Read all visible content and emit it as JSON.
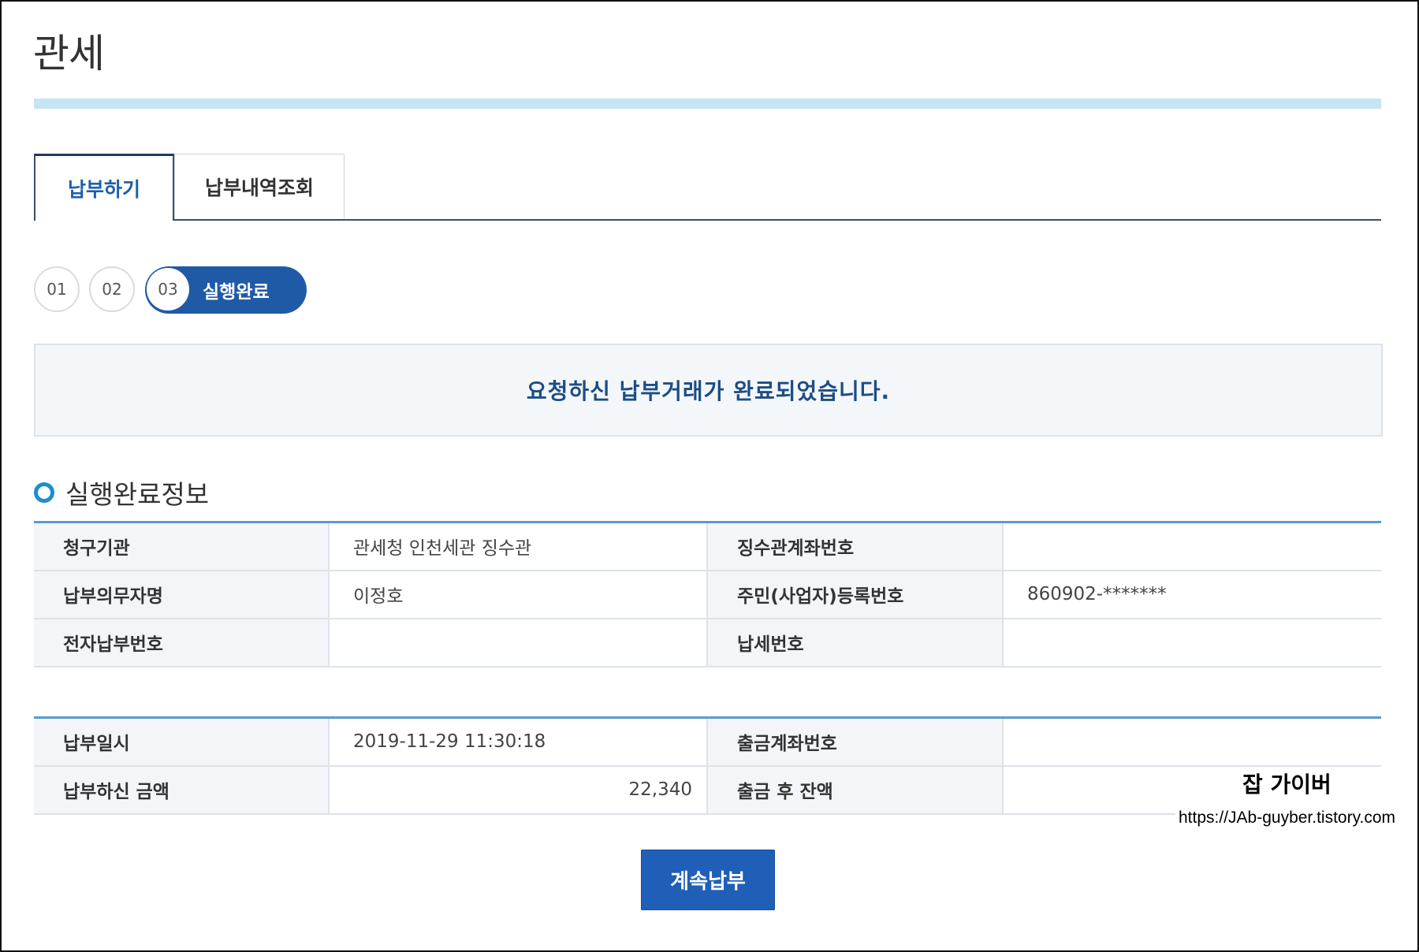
{
  "page": {
    "title": "관세"
  },
  "tabs": [
    {
      "label": "납부하기",
      "active": true
    },
    {
      "label": "납부내역조회",
      "active": false
    }
  ],
  "steps": {
    "items": [
      "01",
      "02",
      "03"
    ],
    "current_label": "실행완료"
  },
  "notice": {
    "message": "요청하신 납부거래가 완료되었습니다."
  },
  "section": {
    "title": "실행완료정보"
  },
  "table1": {
    "rows": [
      {
        "label1": "청구기관",
        "value1": "관세청 인천세관 징수관",
        "label2": "징수관계좌번호",
        "value2": ""
      },
      {
        "label1": "납부의무자명",
        "value1": "이정호",
        "label2": "주민(사업자)등록번호",
        "value2": "860902-*******"
      },
      {
        "label1": "전자납부번호",
        "value1": "",
        "label2": "납세번호",
        "value2": ""
      }
    ]
  },
  "table2": {
    "rows": [
      {
        "label1": "납부일시",
        "value1": "2019-11-29 11:30:18",
        "label2": "출금계좌번호",
        "value2": ""
      },
      {
        "label1": "납부하신 금액",
        "value1": "22,340",
        "label2": "출금 후 잔액",
        "value2": ""
      }
    ]
  },
  "watermark": {
    "title": "잡 가이버",
    "url": "https://JAb-guyber.tistory.com"
  },
  "actions": {
    "continue_label": "계속납부"
  },
  "colors": {
    "accent": "#1f5aa6",
    "title_bar": "#c6e4f3",
    "table_border": "#5a9bd5",
    "notice_text": "#1d4d85"
  }
}
